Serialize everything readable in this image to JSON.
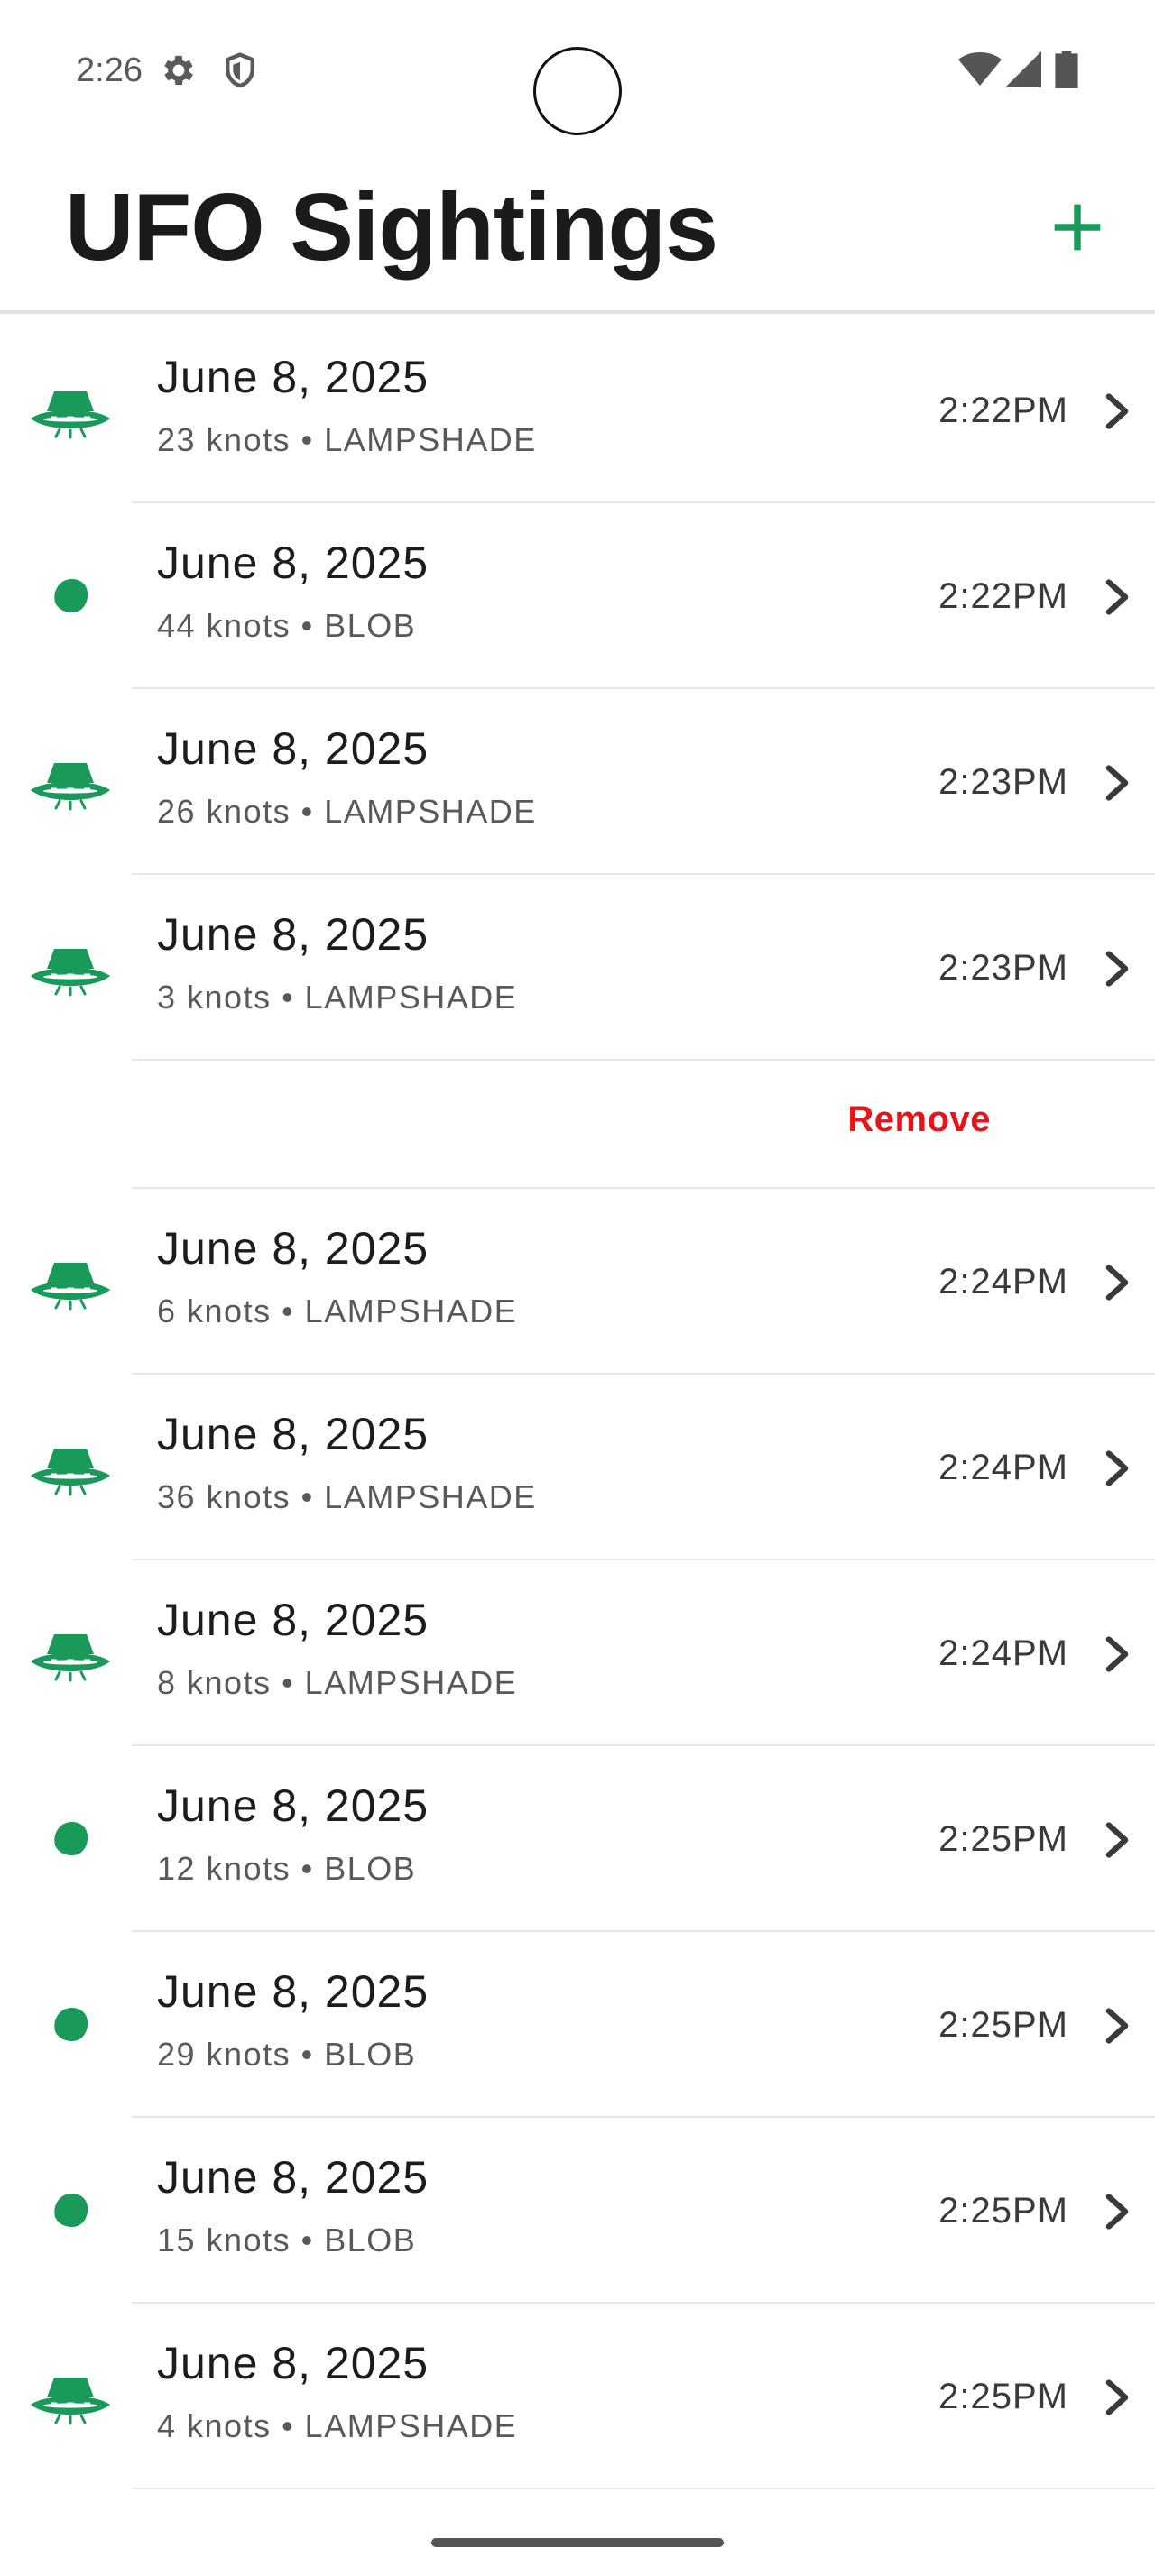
{
  "status_bar": {
    "time": "2:26",
    "icons": [
      "settings-gear-icon",
      "shield-icon",
      "wifi-icon",
      "signal-icon",
      "battery-icon"
    ]
  },
  "header": {
    "title": "UFO Sightings",
    "add_icon": "plus-icon"
  },
  "colors": {
    "accent": "#1a9a5a",
    "remove": "#e8141b",
    "divider": "#e6e6e6"
  },
  "sightings": [
    {
      "date": "June 8, 2025",
      "detail": "23 knots • LAMPSHADE",
      "time": "2:22PM",
      "shape": "lampshade"
    },
    {
      "date": "June 8, 2025",
      "detail": "44 knots • BLOB",
      "time": "2:22PM",
      "shape": "blob"
    },
    {
      "date": "June 8, 2025",
      "detail": "26 knots • LAMPSHADE",
      "time": "2:23PM",
      "shape": "lampshade"
    },
    {
      "date": "June 8, 2025",
      "detail": "3 knots • LAMPSHADE",
      "time": "2:23PM",
      "shape": "lampshade"
    },
    {
      "date": "June 8, 2025",
      "detail": "6 knots • LAMPSHADE",
      "time": "2:24PM",
      "shape": "lampshade"
    },
    {
      "date": "June 8, 2025",
      "detail": "36 knots • LAMPSHADE",
      "time": "2:24PM",
      "shape": "lampshade"
    },
    {
      "date": "June 8, 2025",
      "detail": "8 knots • LAMPSHADE",
      "time": "2:24PM",
      "shape": "lampshade"
    },
    {
      "date": "June 8, 2025",
      "detail": "12 knots • BLOB",
      "time": "2:25PM",
      "shape": "blob"
    },
    {
      "date": "June 8, 2025",
      "detail": "29 knots • BLOB",
      "time": "2:25PM",
      "shape": "blob"
    },
    {
      "date": "June 8, 2025",
      "detail": "15 knots • BLOB",
      "time": "2:25PM",
      "shape": "blob"
    },
    {
      "date": "June 8, 2025",
      "detail": "4 knots • LAMPSHADE",
      "time": "2:25PM",
      "shape": "lampshade"
    }
  ],
  "swipe_action": {
    "after_index": 3,
    "label": "Remove"
  }
}
